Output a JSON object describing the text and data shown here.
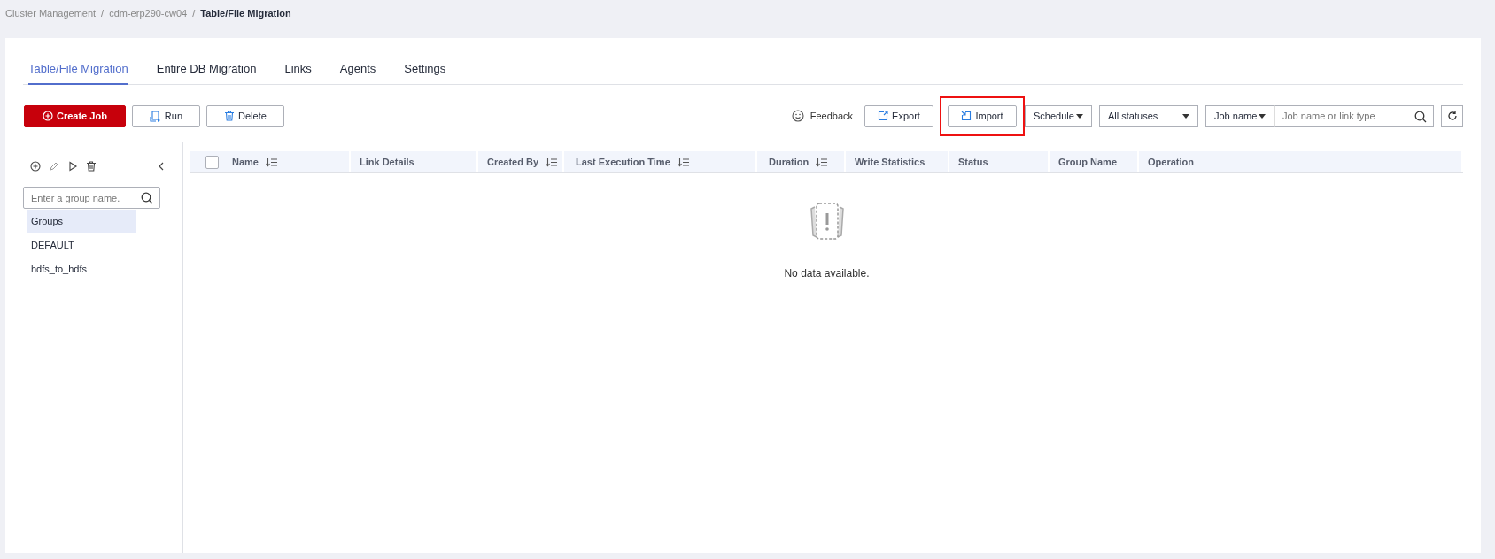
{
  "breadcrumb_separator": "/",
  "breadcrumb": [
    {
      "label": "Cluster Management",
      "current": false
    },
    {
      "label": "cdm-erp290-cw04",
      "current": false
    },
    {
      "label": "Table/File Migration",
      "current": true
    }
  ],
  "tabs": [
    {
      "label": "Table/File Migration",
      "selected": true
    },
    {
      "label": "Entire DB Migration",
      "selected": false
    },
    {
      "label": "Links",
      "selected": false
    },
    {
      "label": "Agents",
      "selected": false
    },
    {
      "label": "Settings",
      "selected": false
    }
  ],
  "toolbar_left": [
    {
      "label": "Create Job",
      "kind": "primary"
    },
    {
      "label": "Run",
      "kind": "run"
    },
    {
      "label": "Delete",
      "kind": "delete"
    }
  ],
  "feedback": "Feedback",
  "toolbar_right": [
    {
      "label": "Export",
      "highlighted": false
    },
    {
      "label": "Import",
      "highlighted": true
    }
  ],
  "schedule_select": "Schedule",
  "status_select": "All statuses",
  "search_type_select": "Job name",
  "search": {
    "placeholder": "Job name or link type"
  },
  "sidebar": {
    "search": {
      "placeholder": "Enter a group name."
    },
    "items": [
      {
        "label": "Groups",
        "selected": true
      },
      {
        "label": "DEFAULT",
        "selected": false
      },
      {
        "label": "hdfs_to_hdfs",
        "selected": false
      }
    ]
  },
  "table": {
    "columns": [
      {
        "label": "Name",
        "sortable": true
      },
      {
        "label": "Link Details",
        "sortable": false
      },
      {
        "label": "Created By",
        "sortable": true
      },
      {
        "label": "Last Execution Time",
        "sortable": true
      },
      {
        "label": "Duration",
        "sortable": true
      },
      {
        "label": "Write Statistics",
        "sortable": false
      },
      {
        "label": "Status",
        "sortable": false
      },
      {
        "label": "Group Name",
        "sortable": false
      },
      {
        "label": "Operation",
        "sortable": false
      }
    ],
    "select_all_checked": false,
    "empty_text": "No data available."
  }
}
